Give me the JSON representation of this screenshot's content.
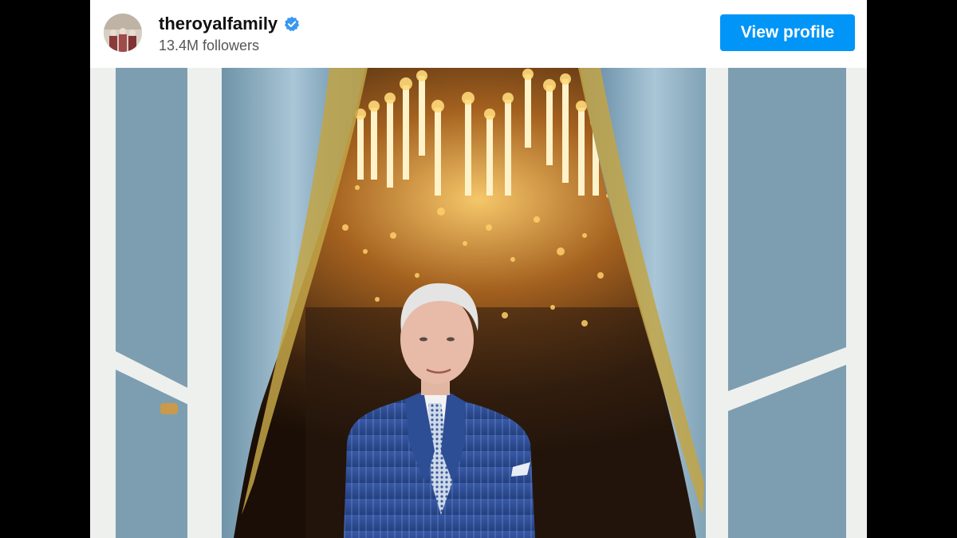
{
  "post_header": {
    "username": "theroyalfamily",
    "followers": "13.4M followers",
    "view_profile_label": "View profile",
    "verified_icon": "verified-badge-icon"
  },
  "colors": {
    "button_blue": "#0095f6",
    "verified_blue": "#3897f0",
    "text_dark": "#111111",
    "text_muted": "#555555",
    "letterbox": "#000000"
  },
  "post_image": {
    "icon": "photo"
  }
}
